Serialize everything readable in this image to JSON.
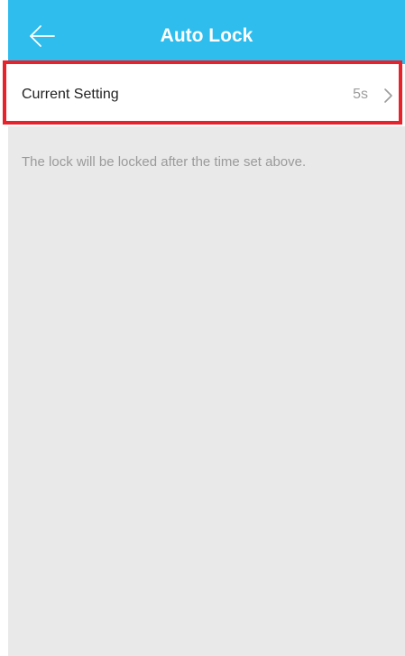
{
  "header": {
    "title": "Auto Lock",
    "back_icon": "arrow-left-icon",
    "background_color": "#2fbdee"
  },
  "setting": {
    "label": "Current Setting",
    "value": "5s",
    "chevron_icon": "chevron-right-icon",
    "highlight_color": "#e8222b"
  },
  "hint": {
    "text": "The lock will be locked after the time set above."
  }
}
